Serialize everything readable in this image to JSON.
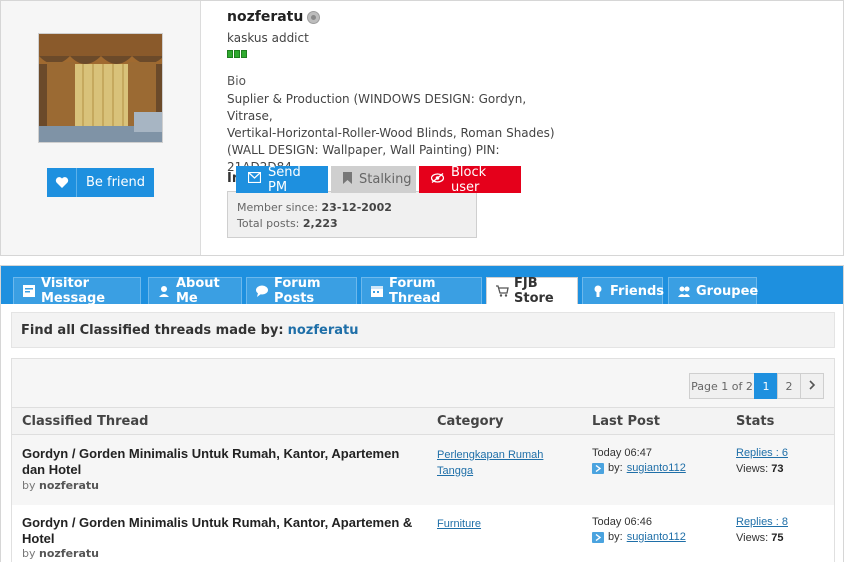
{
  "profile": {
    "username": "nozferatu",
    "rank": "kaskus addict",
    "reputation_bars": 3,
    "befriend_label": "Be friend",
    "bio_title": "Bio",
    "bio_line1": "Suplier & Production (WINDOWS DESIGN: Gordyn, Vitrase,",
    "bio_line2": "Vertikal-Horizontal-Roller-Wood Blinds, Roman Shades)",
    "bio_line3": "(WALL DESIGN: Wallpaper, Wall Painting) PIN: 21AD2D84",
    "info_partial": "In",
    "send_pm_label": "Send PM",
    "stalking_label": "Stalking",
    "block_label": "Block user",
    "member_since_label": "Member since:",
    "member_since_value": "23-12-2002",
    "total_posts_label": "Total posts:",
    "total_posts_value": "2,223"
  },
  "tabs": [
    {
      "label": "Visitor Message",
      "active": false
    },
    {
      "label": "About Me",
      "active": false
    },
    {
      "label": "Forum Posts",
      "active": false
    },
    {
      "label": "Forum Thread",
      "active": false
    },
    {
      "label": "FJB Store",
      "active": true
    },
    {
      "label": "Friends",
      "active": false
    },
    {
      "label": "Groupee",
      "active": false
    }
  ],
  "find": {
    "prefix": "Find all Classified threads made by:",
    "user": "nozferatu"
  },
  "pager": {
    "info": "Page 1 of 2",
    "pages": [
      "1",
      "2"
    ],
    "current": "1",
    "next": "›"
  },
  "table": {
    "headers": [
      "Classified Thread",
      "Category",
      "Last Post",
      "Stats"
    ],
    "rows": [
      {
        "title": "Gordyn / Gorden Minimalis Untuk Rumah, Kantor, Apartemen dan Hotel",
        "by_label": "by",
        "by_user": "nozferatu",
        "category": "Perlengkapan Rumah Tangga",
        "last_time": "Today 06:47",
        "last_by_label": "by:",
        "last_by_user": "sugianto112",
        "replies": "Replies : 6",
        "views_label": "Views:",
        "views_value": "73"
      },
      {
        "title": "Gordyn / Gorden Minimalis Untuk Rumah, Kantor, Apartemen & Hotel",
        "by_label": "by",
        "by_user": "nozferatu",
        "category": "Furniture",
        "last_time": "Today 06:46",
        "last_by_label": "by:",
        "last_by_user": "sugianto112",
        "replies": "Replies : 8",
        "views_label": "Views:",
        "views_value": "75"
      }
    ]
  },
  "colors": {
    "accent": "#1e90df",
    "block": "#e5001b",
    "link": "#1f6fa8",
    "reputation": "#2faa2f"
  },
  "icons": {
    "status": "offline-status-icon",
    "heart": "heart-icon",
    "envelope": "envelope-icon",
    "bookmark": "bookmark-icon",
    "eye_block": "eye-block-icon"
  }
}
